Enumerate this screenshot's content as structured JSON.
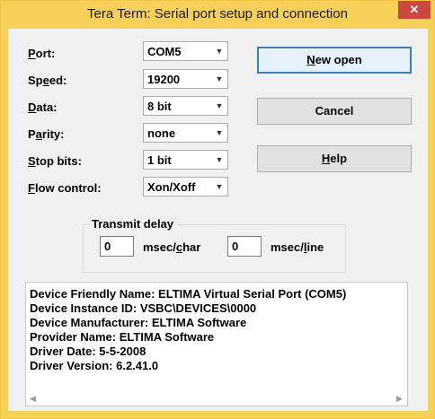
{
  "window": {
    "title": "Tera Term: Serial port setup and connection"
  },
  "fields": [
    {
      "label_pre": "",
      "label_ul": "P",
      "label_post": "ort:",
      "value": "COM5"
    },
    {
      "label_pre": "Sp",
      "label_ul": "e",
      "label_post": "ed:",
      "value": "19200"
    },
    {
      "label_pre": "",
      "label_ul": "D",
      "label_post": "ata:",
      "value": "8 bit"
    },
    {
      "label_pre": "P",
      "label_ul": "a",
      "label_post": "rity:",
      "value": "none"
    },
    {
      "label_pre": "",
      "label_ul": "S",
      "label_post": "top bits:",
      "value": "1 bit"
    },
    {
      "label_pre": "",
      "label_ul": "F",
      "label_post": "low control:",
      "value": "Xon/Xoff"
    }
  ],
  "buttons": {
    "new_open": {
      "pre": "",
      "ul": "N",
      "post": "ew open"
    },
    "cancel": "Cancel",
    "help": {
      "pre": "",
      "ul": "H",
      "post": "elp"
    }
  },
  "transmit_delay": {
    "title": "Transmit delay",
    "char_value": "0",
    "char_label_pre": "msec/",
    "char_label_ul": "c",
    "char_label_post": "har",
    "line_value": "0",
    "line_label_pre": "msec/",
    "line_label_ul": "l",
    "line_label_post": "ine"
  },
  "device_info": [
    "Device Friendly Name: ELTIMA Virtual Serial Port (COM5)",
    "Device Instance ID: VSBC\\DEVICES\\0000",
    "Device Manufacturer: ELTIMA Software",
    "Provider Name: ELTIMA Software",
    "Driver Date: 5-5-2008",
    "Driver Version: 6.2.41.0"
  ],
  "icons": {
    "close": "close-icon",
    "dropdown": "chevron-down-icon",
    "scroll_left": "scroll-left-icon",
    "scroll_right": "scroll-right-icon"
  },
  "colors": {
    "titlebar": "#f7d05a",
    "close_button": "#c94a3b",
    "default_button_border": "#3c7fb1",
    "dialog_background": "#f0f0f0"
  }
}
